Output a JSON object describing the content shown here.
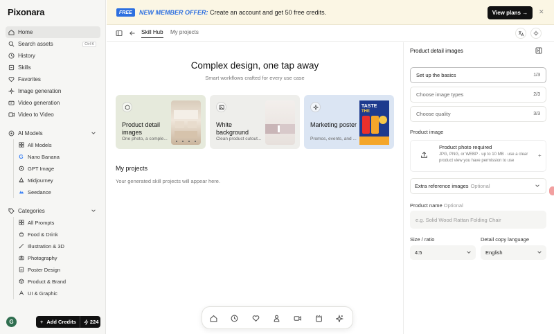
{
  "app": {
    "logo": "Pixonara"
  },
  "sidebar": {
    "nav": [
      {
        "label": "Home",
        "icon": "home-icon",
        "active": true
      },
      {
        "label": "Search assets",
        "icon": "search-icon",
        "shortcut": "Ctrl K"
      },
      {
        "label": "History",
        "icon": "history-icon"
      },
      {
        "label": "Skills",
        "icon": "skills-icon"
      },
      {
        "label": "Favorites",
        "icon": "heart-icon"
      },
      {
        "label": "Image generation",
        "icon": "image-gen-icon"
      },
      {
        "label": "Video generation",
        "icon": "video-gen-icon"
      },
      {
        "label": "Video to Video",
        "icon": "video-to-video-icon"
      }
    ],
    "ai_models": {
      "label": "AI Models",
      "items": [
        {
          "label": "All Models",
          "icon": "grid-icon"
        },
        {
          "label": "Nano Banana",
          "icon": "google-icon"
        },
        {
          "label": "GPT Image",
          "icon": "openai-icon"
        },
        {
          "label": "Midjourney",
          "icon": "midjourney-icon"
        },
        {
          "label": "Seedance",
          "icon": "seedance-icon"
        }
      ]
    },
    "categories": {
      "label": "Categories",
      "items": [
        {
          "label": "All Prompts",
          "icon": "grid-icon"
        },
        {
          "label": "Food & Drink",
          "icon": "food-icon"
        },
        {
          "label": "Illustration & 3D",
          "icon": "brush-icon"
        },
        {
          "label": "Photography",
          "icon": "camera-icon"
        },
        {
          "label": "Poster Design",
          "icon": "poster-icon"
        },
        {
          "label": "Product & Brand",
          "icon": "product-icon"
        },
        {
          "label": "UI & Graphic",
          "icon": "ui-icon"
        }
      ]
    },
    "avatar_letter": "G",
    "add_credits": "Add Credits",
    "credits": "224"
  },
  "banner": {
    "badge": "FREE",
    "offer_highlight": "NEW MEMBER OFFER:",
    "offer_text": " Create an account and get 50 free credits.",
    "cta": "View plans →"
  },
  "topbar": {
    "tabs": [
      "Skill Hub",
      "My projects"
    ]
  },
  "main": {
    "title": "Complex design, one tap away",
    "subtitle": "Smart workflows crafted for every use case",
    "cards": [
      {
        "title": "Product detail images",
        "desc": "One photo, a comple...",
        "bg": "#e6eadc"
      },
      {
        "title": "White background",
        "desc": "Clean product cutout...",
        "bg": "#eeeeeb"
      },
      {
        "title": "Marketing poster",
        "desc": "Promos, events, and ...",
        "bg": "#dbe5f3"
      }
    ],
    "projects_title": "My projects",
    "projects_empty": "Your generated skill projects will appear here."
  },
  "panel": {
    "title": "Product detail images",
    "steps": [
      {
        "label": "Set up the basics",
        "num": "1/3"
      },
      {
        "label": "Choose image types",
        "num": "2/3"
      },
      {
        "label": "Choose quality",
        "num": "3/3"
      }
    ],
    "product_image_label": "Product image",
    "upload_title": "Product photo required",
    "upload_desc": "JPG, PNG, or WEBP · up to 10 MB · use a clear product view you have permission to use",
    "extra_label": "Extra reference images",
    "extra_optional": "Optional",
    "name_label": "Product name",
    "name_optional": "Optional",
    "name_placeholder": "e.g. Solid Wood Rattan Folding Chair",
    "size_label": "Size / ratio",
    "size_value": "4:5",
    "lang_label": "Detail copy language",
    "lang_value": "English"
  }
}
